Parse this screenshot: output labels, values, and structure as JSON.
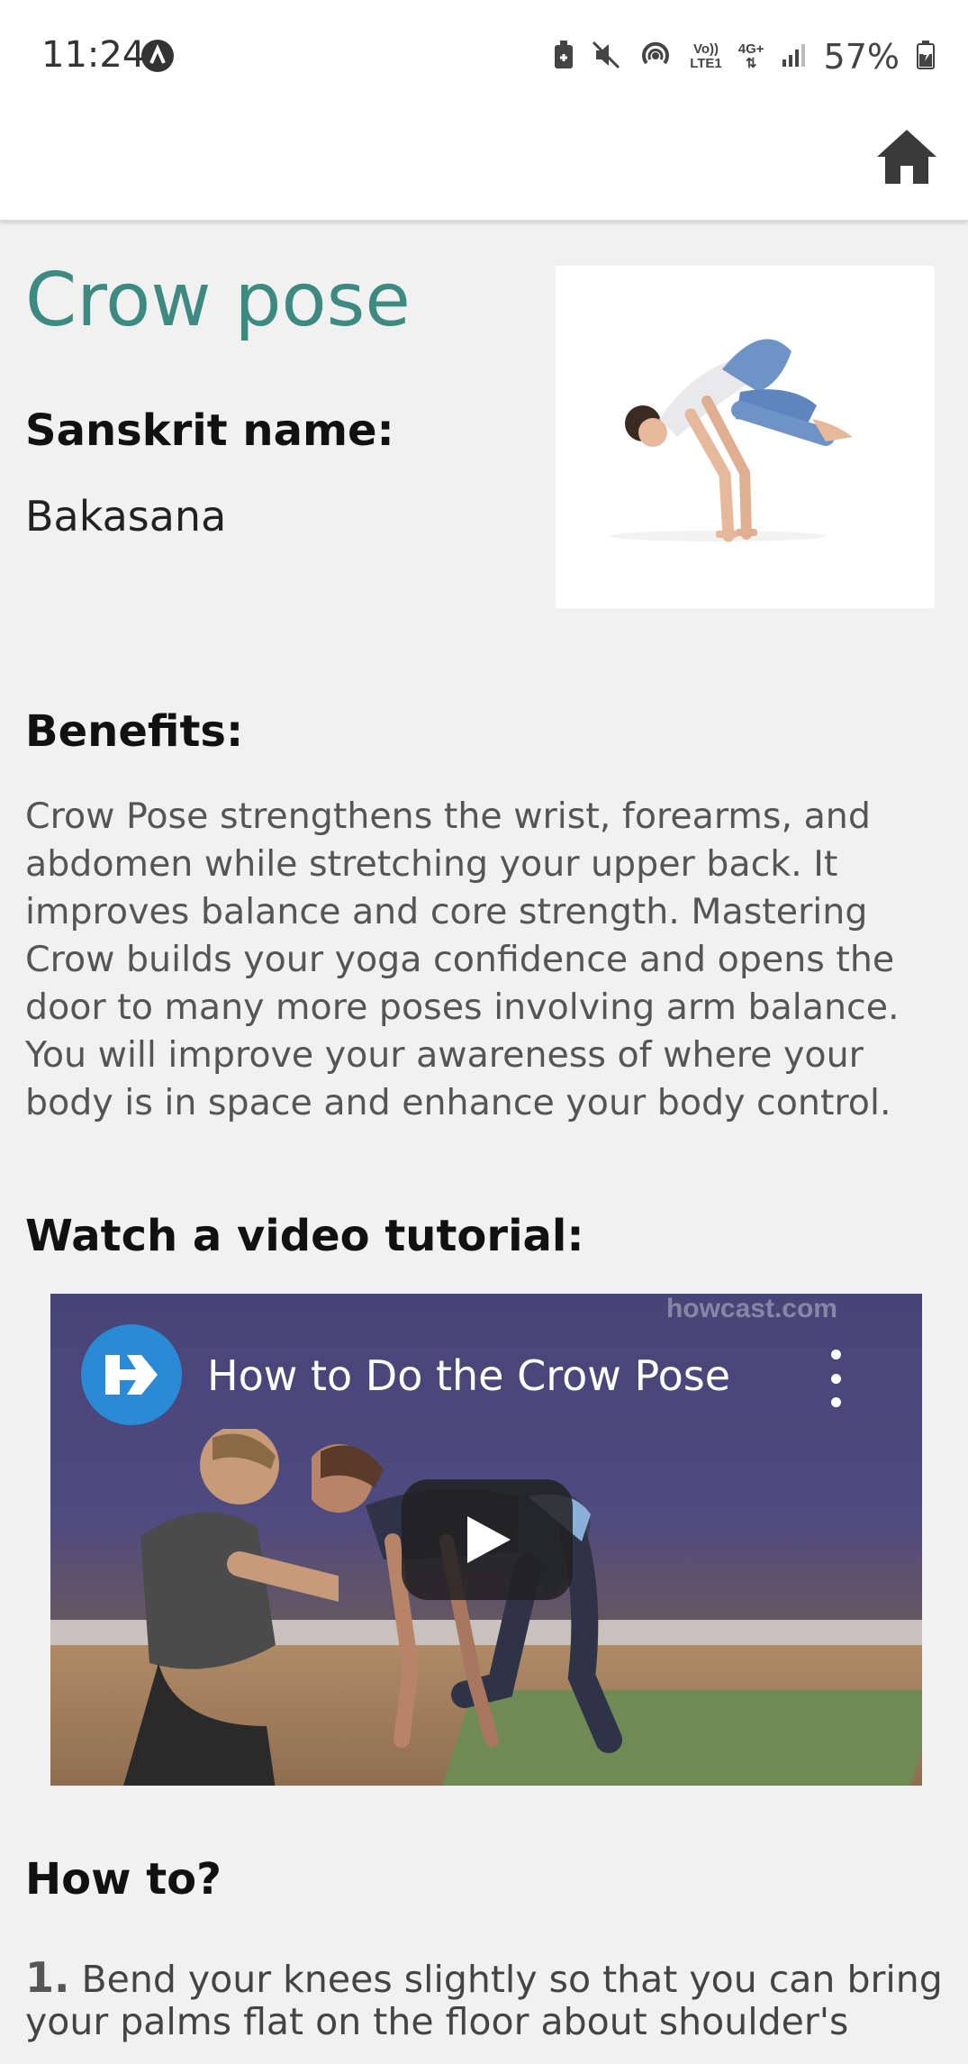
{
  "status_bar": {
    "time": "11:24",
    "network_top": "Vo))",
    "network_bottom": "LTE1",
    "network_type": "4G+",
    "battery": "57%",
    "icons": [
      "assistant-icon",
      "battery-saver-icon",
      "mute-icon",
      "hotspot-icon",
      "signal-icon",
      "battery-icon"
    ]
  },
  "app_bar": {
    "home_icon": "home-icon"
  },
  "pose": {
    "title": "Crow pose",
    "sanskrit_heading": "Sanskrit name:",
    "sanskrit_value": "Bakasana",
    "benefits_heading": "Benefits:",
    "benefits_text": "Crow Pose strengthens the wrist, forearms, and abdomen while stretching your upper back. It improves balance and core strength. Mastering Crow builds your yoga confidence and opens the door to many more poses involving arm balance. You will improve your awareness of where your body is in space and enhance your body control.",
    "video_heading": "Watch a video tutorial:",
    "howto_heading": "How to?"
  },
  "video": {
    "title": "How to Do the Crow Pose",
    "watermark": "howcast.com",
    "play_icon": "play-icon",
    "menu_icon": "more-vert-icon",
    "logo_icon": "howcast-logo-icon"
  },
  "steps": [
    {
      "number": "1.",
      "line1": " Bend your knees slightly so that you can bring",
      "line2": "your palms flat on the floor about shoulder's"
    }
  ]
}
